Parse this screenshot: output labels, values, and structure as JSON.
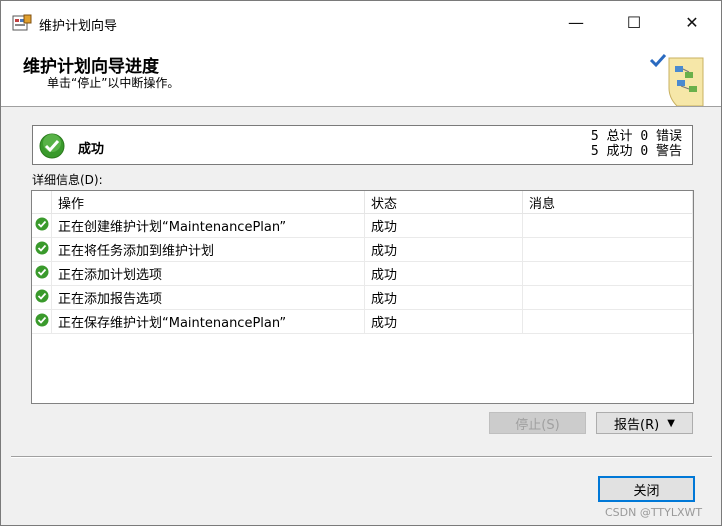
{
  "window": {
    "title": "维护计划向导",
    "min_label": "—",
    "max_label": "☐",
    "close_label": "✕"
  },
  "header": {
    "title": "维护计划向导进度",
    "subtitle": "单击“停止”以中断操作。"
  },
  "status": {
    "text": "成功",
    "total_count": "5",
    "total_label": "总计",
    "error_count": "0",
    "error_label": "错误",
    "success_count": "5",
    "success_label": "成功",
    "warning_count": "0",
    "warning_label": "警告"
  },
  "details": {
    "label": "详细信息(D):",
    "columns": [
      "操作",
      "状态",
      "消息"
    ],
    "rows": [
      {
        "action": "正在创建维护计划“MaintenancePlan”",
        "status": "成功",
        "message": "",
        "icon": "success-icon"
      },
      {
        "action": "正在将任务添加到维护计划",
        "status": "成功",
        "message": "",
        "icon": "success-icon"
      },
      {
        "action": "正在添加计划选项",
        "status": "成功",
        "message": "",
        "icon": "success-icon"
      },
      {
        "action": "正在添加报告选项",
        "status": "成功",
        "message": "",
        "icon": "success-icon"
      },
      {
        "action": "正在保存维护计划“MaintenancePlan”",
        "status": "成功",
        "message": "",
        "icon": "success-icon"
      }
    ]
  },
  "buttons": {
    "stop": "停止(S)",
    "report": "报告(R)",
    "report_arrow": "▼",
    "close": "关闭"
  },
  "watermark": "CSDN @TTYLXWT",
  "colors": {
    "success_green": "#3a9a2c",
    "accent_blue": "#0078d7"
  }
}
